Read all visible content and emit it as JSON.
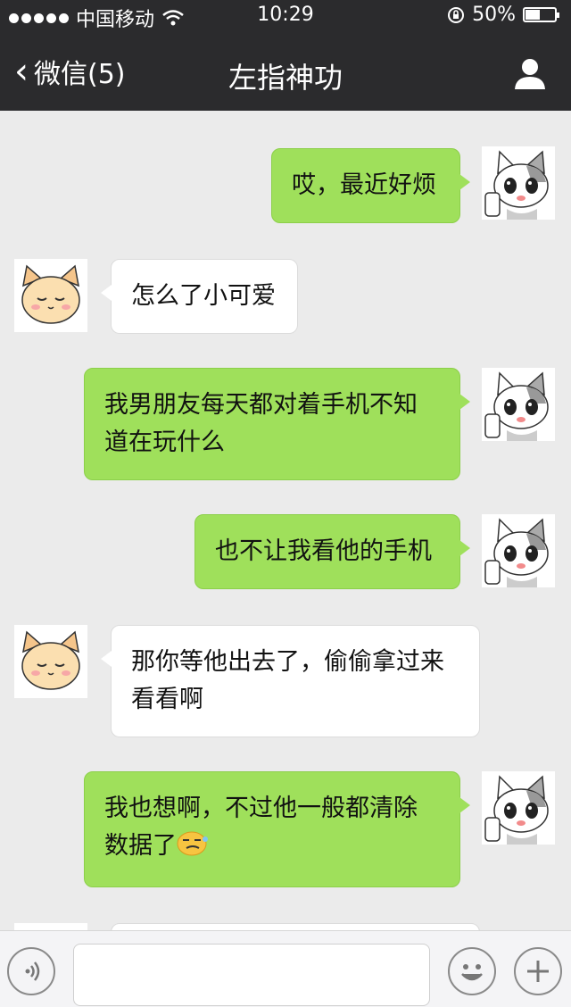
{
  "status_bar": {
    "carrier": "中国移动",
    "time": "10:29",
    "battery_percent_text": "50%",
    "battery_level": 0.5,
    "signal_icon": "signal-dots-icon",
    "wifi_icon": "wifi-icon",
    "rotation_lock_icon": "rotation-lock-icon"
  },
  "nav": {
    "back_label": "微信(5)",
    "title": "左指神功",
    "profile_icon": "person-icon"
  },
  "messages": [
    {
      "side": "me",
      "lines": [
        "哎，最近好烦"
      ]
    },
    {
      "side": "them",
      "lines": [
        "怎么了小可爱"
      ]
    },
    {
      "side": "me",
      "lines": [
        "我男朋友每天都对着手机不知",
        "道在玩什么"
      ]
    },
    {
      "side": "me",
      "lines": [
        "也不让我看他的手机"
      ]
    },
    {
      "side": "them",
      "lines": [
        "那你等他出去了，偷偷拿过来",
        "看看啊"
      ]
    },
    {
      "side": "me",
      "lines": [
        "我也想啊，不过他一般都清除",
        "数据了"
      ],
      "emoji": "smirk-emoji-icon"
    }
  ],
  "input_bar": {
    "voice_icon": "voice-icon",
    "text_value": "",
    "emoji_icon": "smiley-icon",
    "plus_icon": "plus-icon"
  },
  "colors": {
    "header_bg": "#2b2b2d",
    "chat_bg": "#ebebeb",
    "my_bubble": "#9fe05b",
    "their_bubble": "#ffffff"
  }
}
